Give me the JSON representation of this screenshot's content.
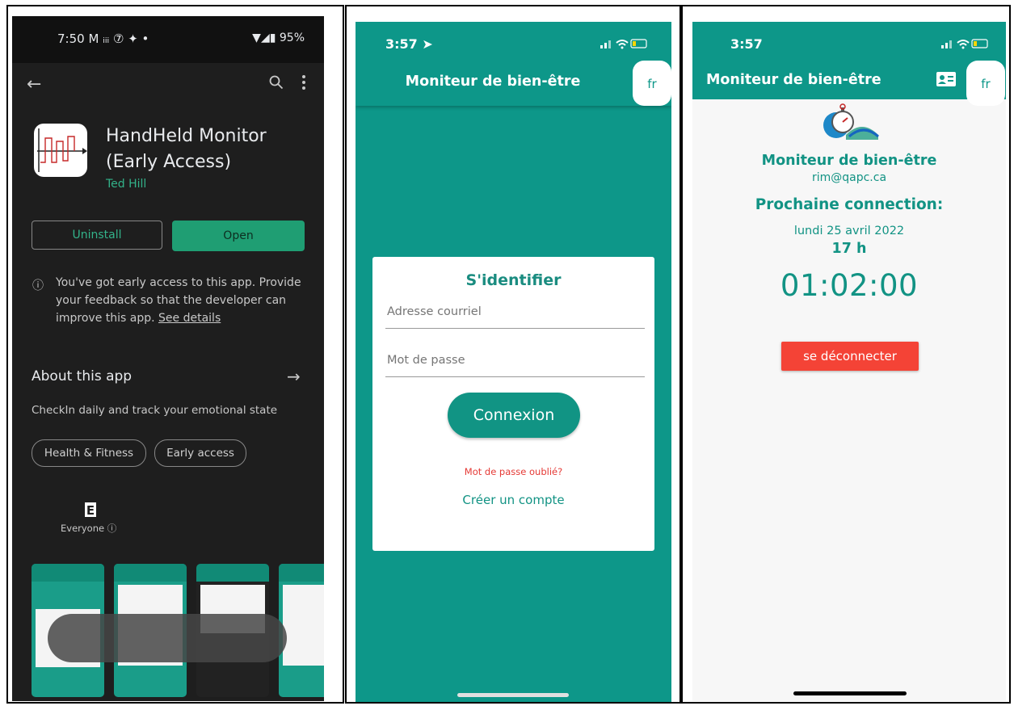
{
  "play_store": {
    "status_time": "7:50",
    "status_icons": "M ᵢᵢᵢ ⑦ ✦ •",
    "battery": "95%",
    "app_name": "HandHeld Monitor (Early Access)",
    "developer": "Ted Hill",
    "uninstall_label": "Uninstall",
    "open_label": "Open",
    "early_access_text": "You've got early access to this app. Provide your feedback so that the developer can improve this app.",
    "see_details": "See details",
    "about_title": "About this app",
    "description": "CheckIn daily and track your emotional state",
    "chips": [
      "Health & Fitness",
      "Early access"
    ],
    "rating_label": "Everyone"
  },
  "login": {
    "status_time": "3:57",
    "title": "Moniteur de bien-être",
    "lang_button": "fr",
    "card_title": "S'identifier",
    "email_placeholder": "Adresse courriel",
    "password_placeholder": "Mot de passe",
    "login_button": "Connexion",
    "forgot_password": "Mot de passe oublié?",
    "create_account": "Créer un compte"
  },
  "dashboard": {
    "status_time": "3:57",
    "title": "Moniteur de bien-être",
    "lang_button": "fr",
    "app_title": "Moniteur de bien-être",
    "email": "rim@qapc.ca",
    "next_connection_label": "Prochaine connection:",
    "date": "lundi 25 avril 2022",
    "hour": "17 h",
    "countdown": "01:02:00",
    "logout_button": "se déconnecter"
  },
  "colors": {
    "teal": "#0d9789",
    "play_green": "#1f9e73",
    "red": "#f44336"
  }
}
